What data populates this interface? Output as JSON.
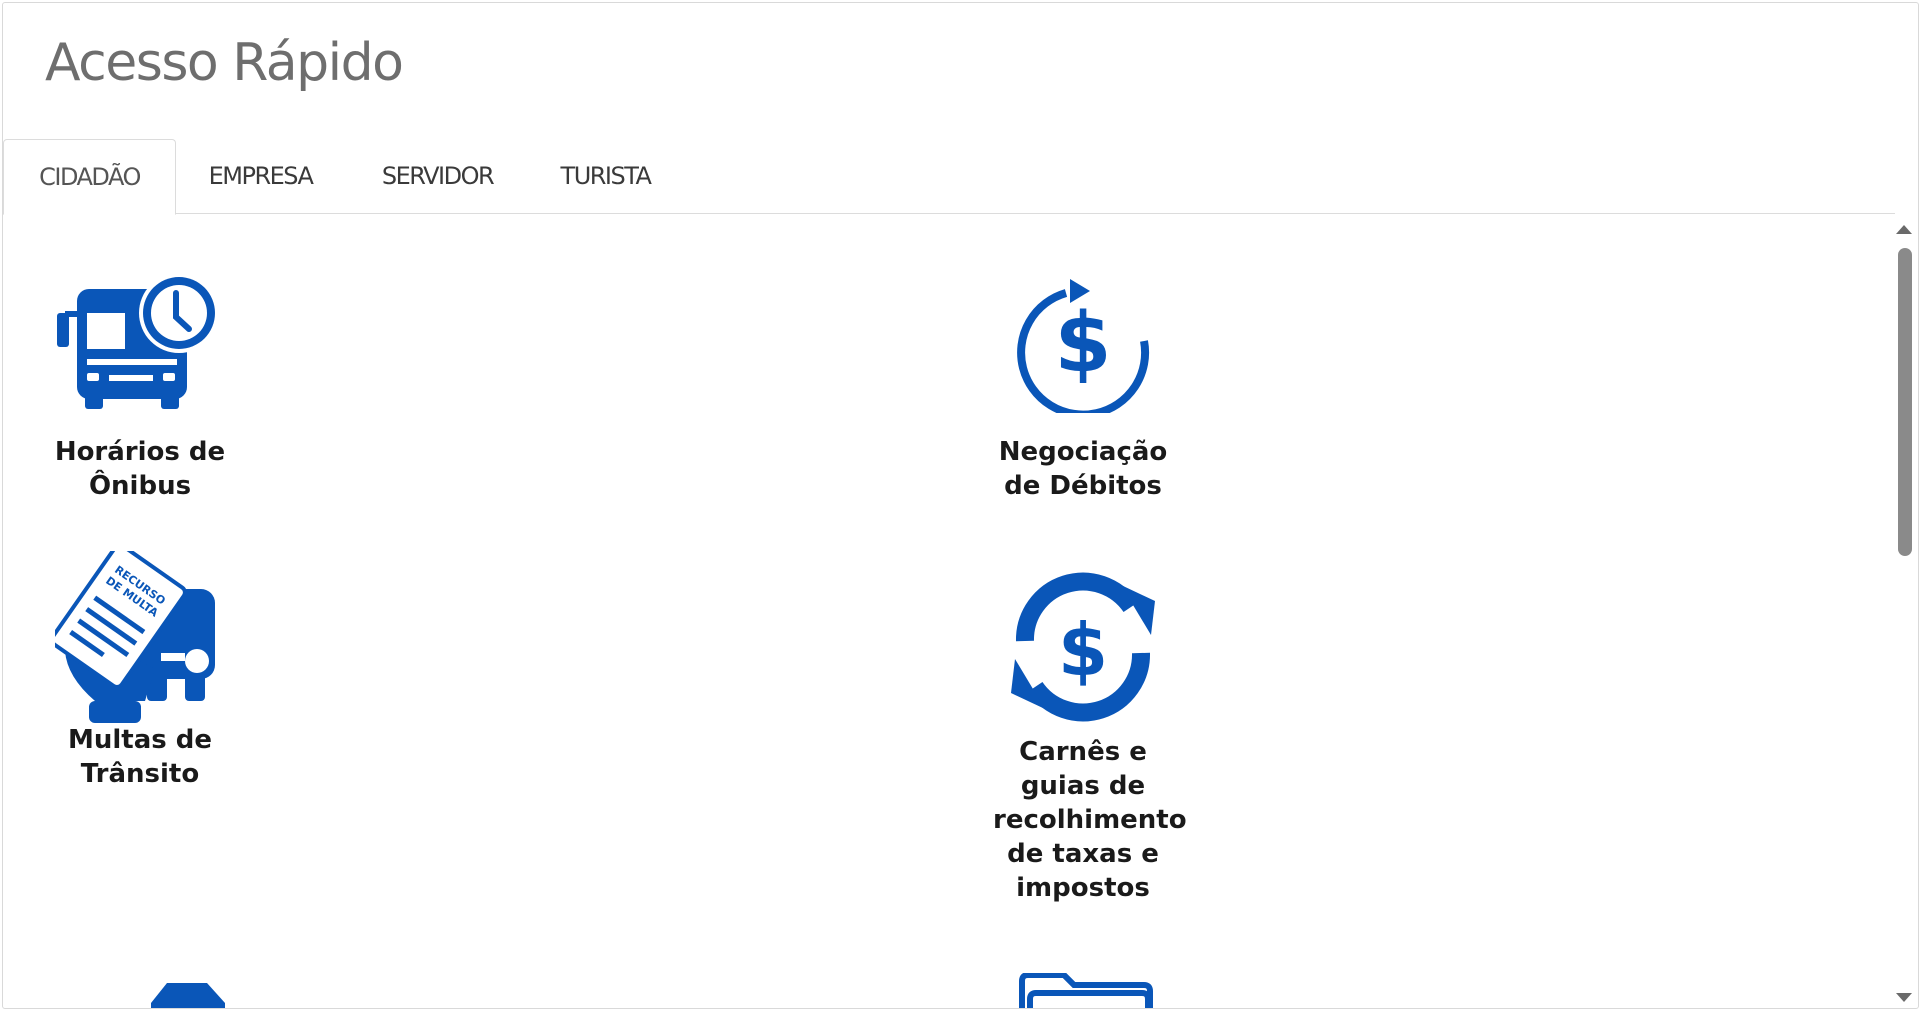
{
  "header": {
    "title": "Acesso Rápido"
  },
  "tabs": [
    {
      "label": "CIDADÃO",
      "active": true
    },
    {
      "label": "EMPRESA",
      "active": false
    },
    {
      "label": "SERVIDOR",
      "active": false
    },
    {
      "label": "TURISTA",
      "active": false
    }
  ],
  "tiles": [
    {
      "label": "Horários de Ônibus",
      "icon": "bus-clock-icon"
    },
    {
      "label": "Negociação de Débitos",
      "icon": "dollar-cycle-icon"
    },
    {
      "label": "Multas de Trânsito",
      "icon": "traffic-fine-appeal-icon",
      "icon_text": "RECURSO DE MULTA"
    },
    {
      "label": "Carnês e guias de recolhimento de taxas e impostos",
      "icon": "dollar-exchange-icon"
    },
    {
      "label": "",
      "icon": "building-icon"
    },
    {
      "label": "",
      "icon": "folder-icon"
    }
  ],
  "colors": {
    "icon_blue": "#0a56b8",
    "title_gray": "#6e6e6e",
    "text": "#1a1a1a"
  }
}
